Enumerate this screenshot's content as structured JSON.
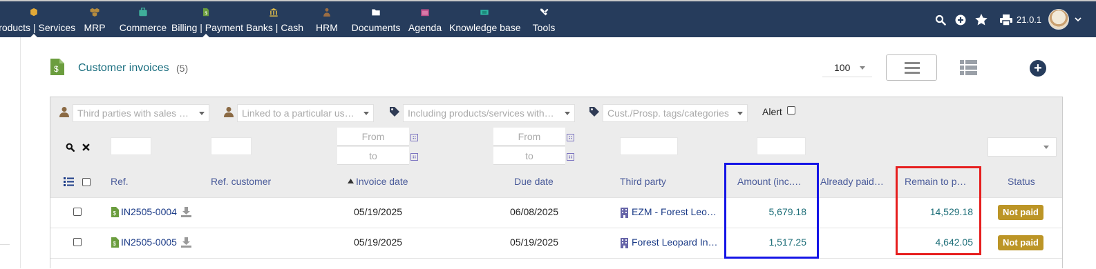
{
  "topbar": {
    "menu": [
      {
        "label": "Products | Services",
        "icon": "cube-icon"
      },
      {
        "label": "MRP",
        "icon": "cubes-icon"
      },
      {
        "label": "Commerce",
        "icon": "suitcase-icon"
      },
      {
        "label": "Billing | Payment",
        "icon": "invoice-icon"
      },
      {
        "label": "Banks | Cash",
        "icon": "bank-icon"
      },
      {
        "label": "HRM",
        "icon": "user-tie-icon"
      },
      {
        "label": "Documents",
        "icon": "folder-open-icon"
      },
      {
        "label": "Agenda",
        "icon": "calendar-icon"
      },
      {
        "label": "Knowledge base",
        "icon": "ticket-icon"
      },
      {
        "label": "Tools",
        "icon": "tools-icon"
      }
    ],
    "version": "21.0.1"
  },
  "page": {
    "title": "Customer invoices",
    "count": "(5)",
    "limit": "100"
  },
  "filters": {
    "third_parties_placeholder": "Third parties with sales …",
    "linked_user_placeholder": "Linked to a particular us…",
    "products_placeholder": "Including products/services with…",
    "tags_placeholder": "Cust./Prosp. tags/categories",
    "alert_label": "Alert",
    "from_label": "From",
    "to_label": "to"
  },
  "columns": {
    "ref": "Ref.",
    "ref_customer": "Ref. customer",
    "invoice_date": "Invoice date",
    "due_date": "Due date",
    "third_party": "Third party",
    "amount": "Amount (inc.…",
    "already_paid": "Already paid…",
    "remain": "Remain to p…",
    "status": "Status"
  },
  "rows": [
    {
      "ref": "IN2505-0004",
      "invoice_date": "05/19/2025",
      "due_date": "06/08/2025",
      "third_party": "EZM - Forest Leo…",
      "amount": "5,679.18",
      "remain": "14,529.18",
      "status": "Not paid"
    },
    {
      "ref": "IN2505-0005",
      "invoice_date": "05/19/2025",
      "due_date": "05/19/2025",
      "third_party": "Forest Leopard In…",
      "amount": "1,517.25",
      "remain": "4,642.05",
      "status": "Not paid"
    }
  ],
  "colors": {
    "topbar": "#263c5c",
    "badge": "#bc9526",
    "highlight_amount": "#1515e6",
    "highlight_remain": "#e61e1e"
  }
}
